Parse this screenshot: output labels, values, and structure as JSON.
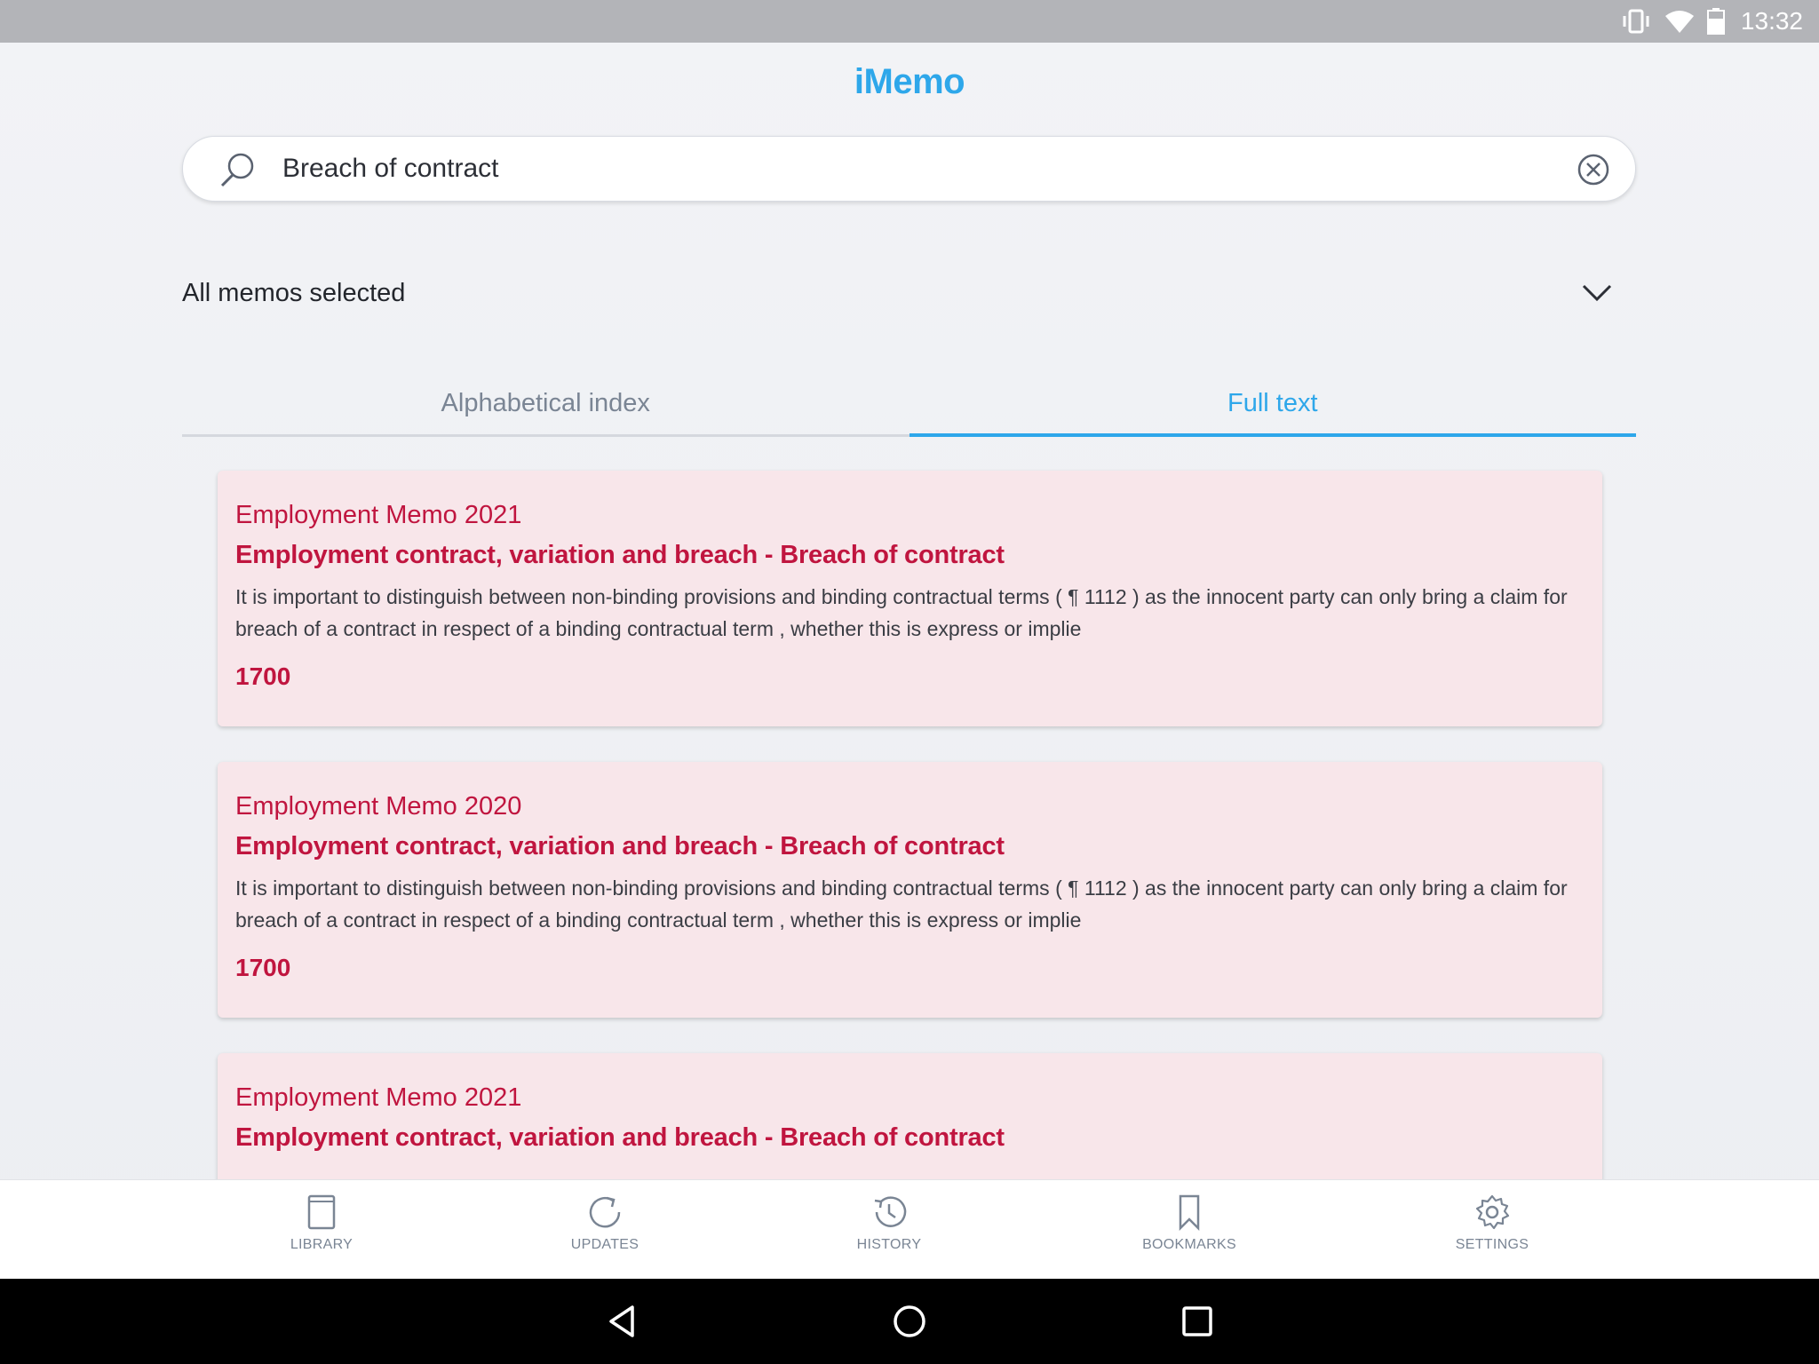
{
  "status_bar": {
    "time": "13:32"
  },
  "app": {
    "title": "iMemo"
  },
  "search": {
    "value": "Breach of contract",
    "placeholder": ""
  },
  "filter": {
    "label": "All memos selected"
  },
  "tabs": [
    {
      "label": "Alphabetical index",
      "active": false
    },
    {
      "label": "Full text",
      "active": true
    }
  ],
  "results": [
    {
      "memo": "Employment Memo 2021",
      "heading": "Employment contract, variation and breach - Breach of contract",
      "text": "It is important to distinguish between non-binding provisions and binding contractual terms ( ¶ 1112 ) as the innocent party can only bring a claim for breach of a contract in respect of a binding contractual term , whether this is express or implie",
      "paragraph": "1700"
    },
    {
      "memo": "Employment Memo 2020",
      "heading": "Employment contract, variation and breach - Breach of contract",
      "text": "It is important to distinguish between non-binding provisions and binding contractual terms ( ¶ 1112 ) as the innocent party can only bring a claim for breach of a contract in respect of a binding contractual term , whether this is express or implie",
      "paragraph": "1700"
    },
    {
      "memo": "Employment Memo 2021",
      "heading": "Employment contract, variation and breach - Breach of contract",
      "text": "",
      "paragraph": ""
    }
  ],
  "bottom_nav": [
    {
      "label": "LIBRARY",
      "icon": "book-icon"
    },
    {
      "label": "UPDATES",
      "icon": "refresh-icon"
    },
    {
      "label": "HISTORY",
      "icon": "history-icon"
    },
    {
      "label": "BOOKMARKS",
      "icon": "bookmark-icon"
    },
    {
      "label": "SETTINGS",
      "icon": "gear-icon"
    }
  ],
  "colors": {
    "accent": "#2ea7ea",
    "result_text": "#c0153f",
    "card_background": "#f8e6ea"
  }
}
